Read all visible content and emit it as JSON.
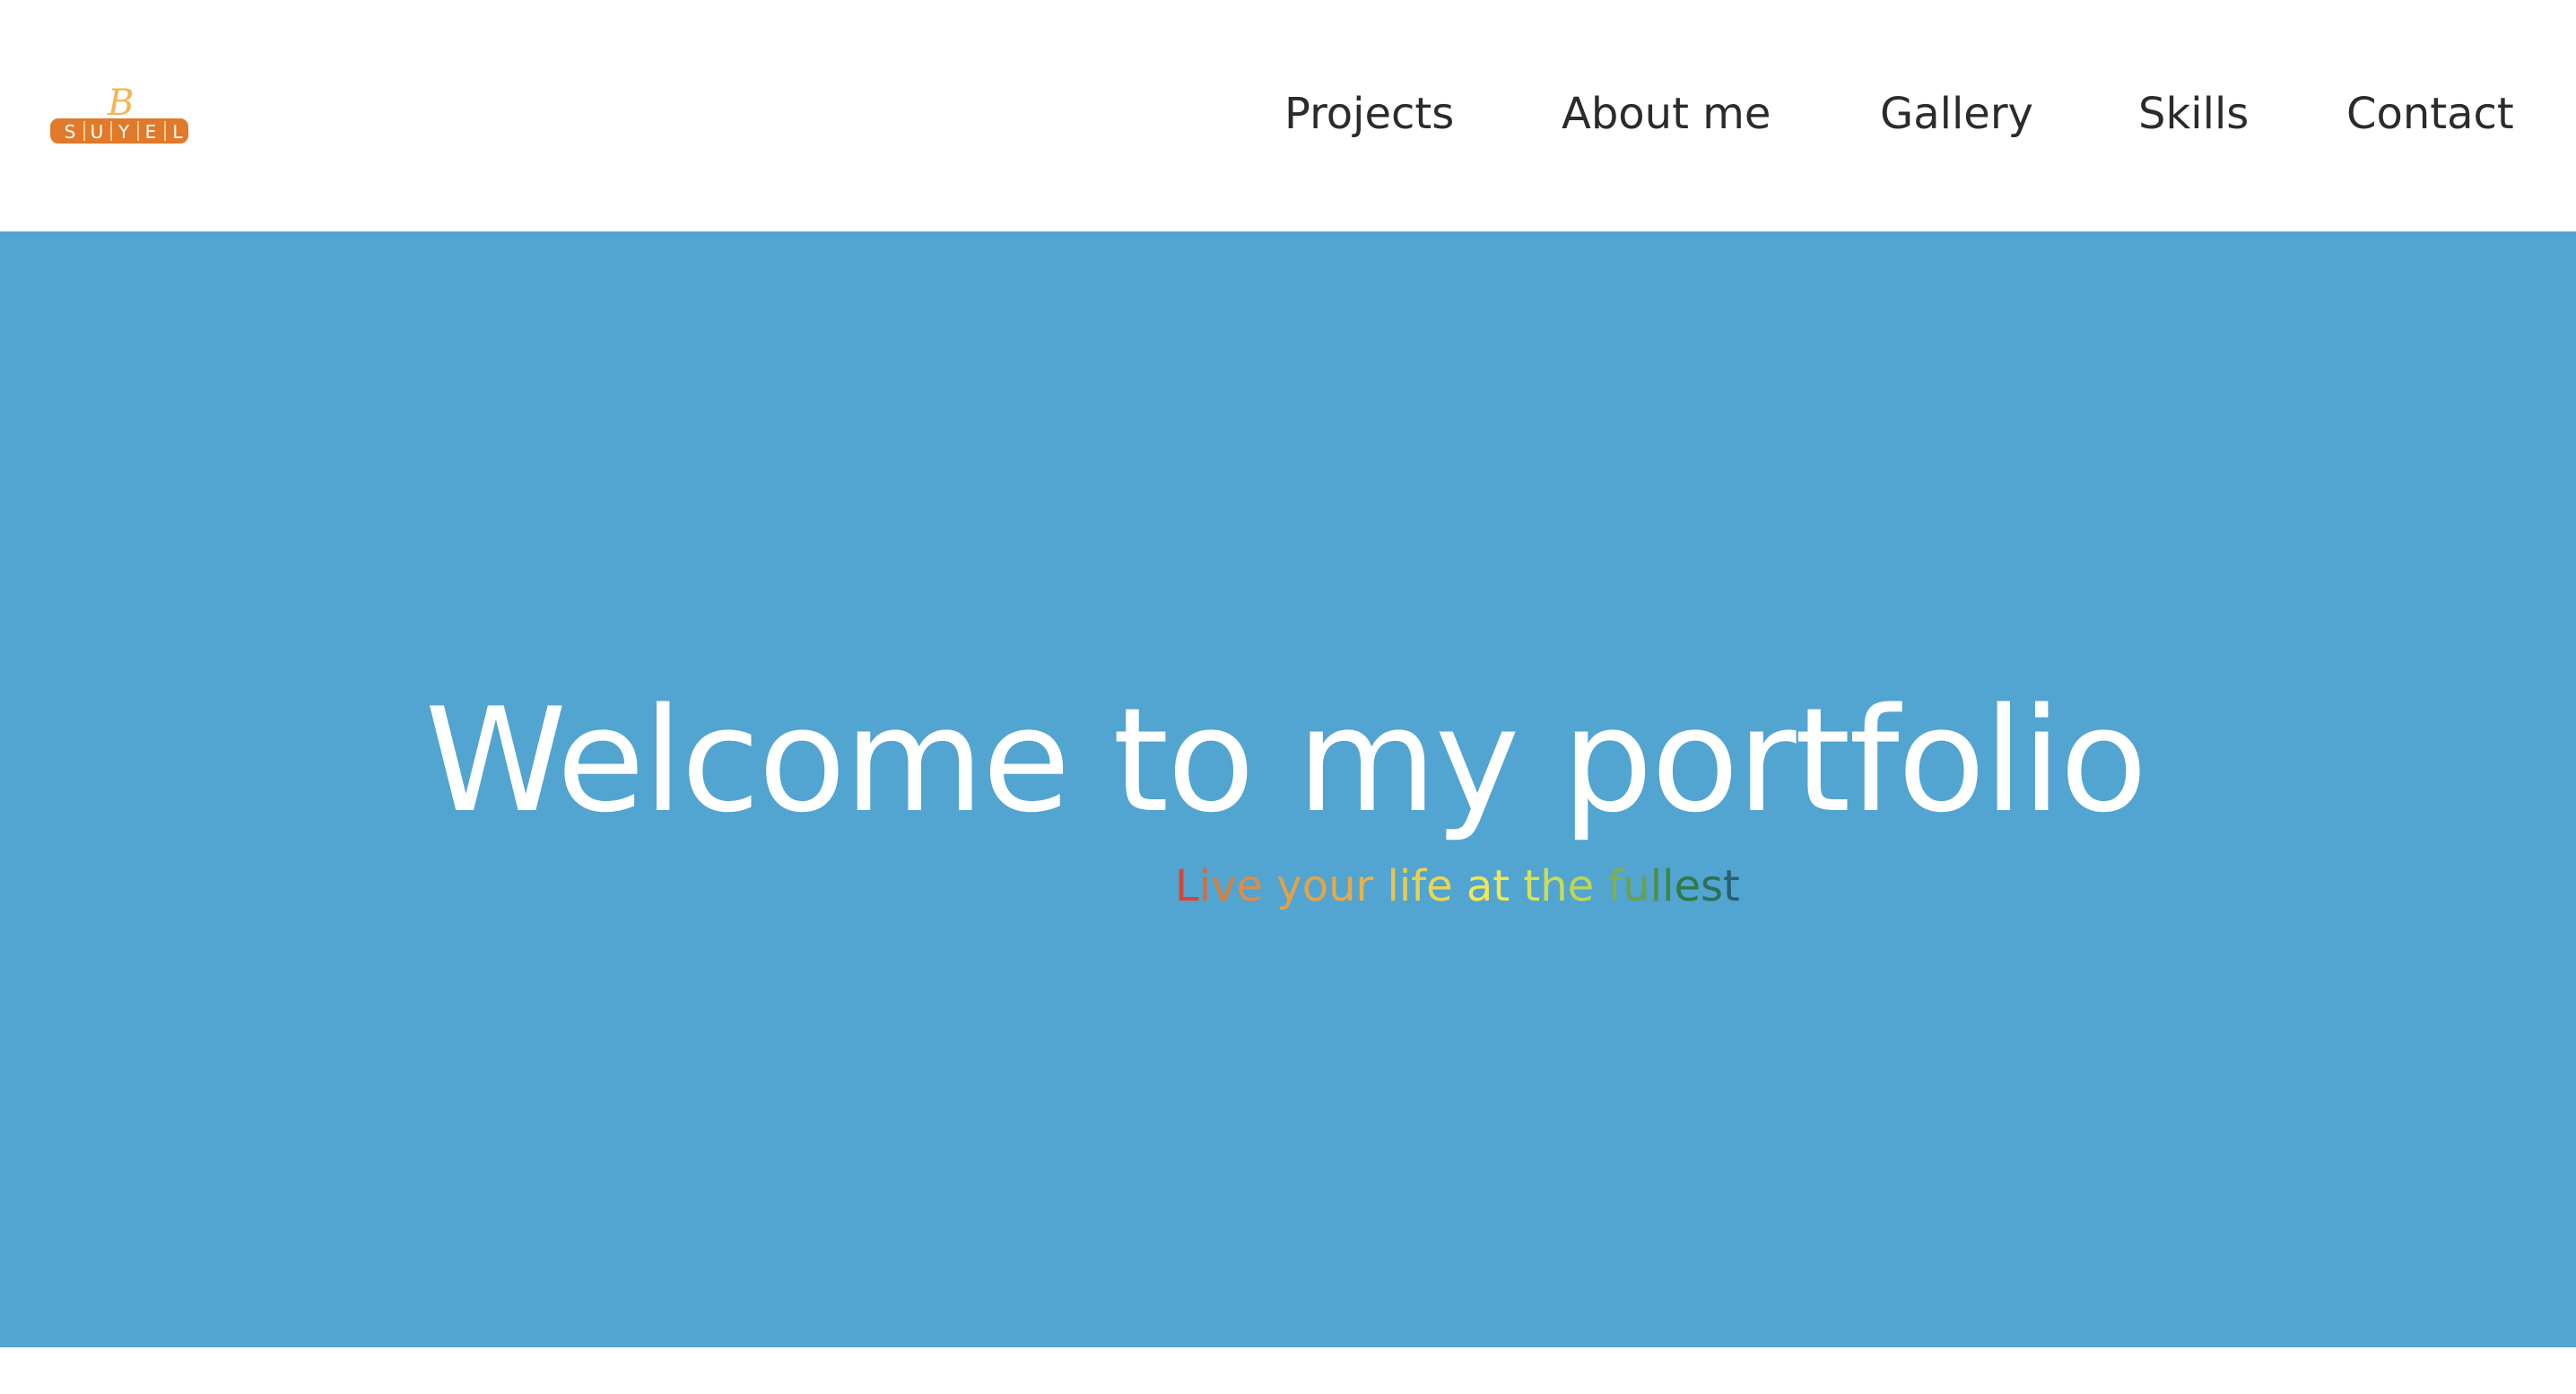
{
  "header": {
    "logo": {
      "script_letter": "B",
      "wordmark_letters": [
        "S",
        "U",
        "Y",
        "E",
        "L"
      ]
    },
    "nav": [
      {
        "label": "Projects"
      },
      {
        "label": "About me"
      },
      {
        "label": "Gallery"
      },
      {
        "label": "Skills"
      },
      {
        "label": "Contact"
      }
    ]
  },
  "hero": {
    "title": "Welcome to my portfolio",
    "tagline_words": [
      {
        "text": "Live",
        "colors": [
          "#d8452d",
          "#d86a3a",
          "#d97f3e",
          "#dc8e46"
        ]
      },
      {
        "text": "your",
        "colors": [
          "#e3a146",
          "#e3a347",
          "#e6aa49",
          "#e8b24a"
        ]
      },
      {
        "text": "life",
        "colors": [
          "#e9c34d",
          "#ebcb4f",
          "#ecd051",
          "#ecd553"
        ]
      },
      {
        "text": "at",
        "colors": [
          "#f1e756",
          "#f0e756"
        ]
      },
      {
        "text": "the",
        "colors": [
          "#d8e357",
          "#c9dd55",
          "#bcd654"
        ]
      },
      {
        "text": "fullest",
        "colors": [
          "#7fb04a",
          "#6aa14a",
          "#4f8f42",
          "#3f8740",
          "#2f7a45",
          "#2d6e59",
          "#2a5f73"
        ]
      }
    ]
  },
  "colors": {
    "hero_background": "#52a4d1",
    "header_background": "#ffffff",
    "nav_text": "#2b2b2b",
    "title_text": "#ffffff",
    "logo_orange": "#e07a2a",
    "logo_light": "#f3b554"
  }
}
